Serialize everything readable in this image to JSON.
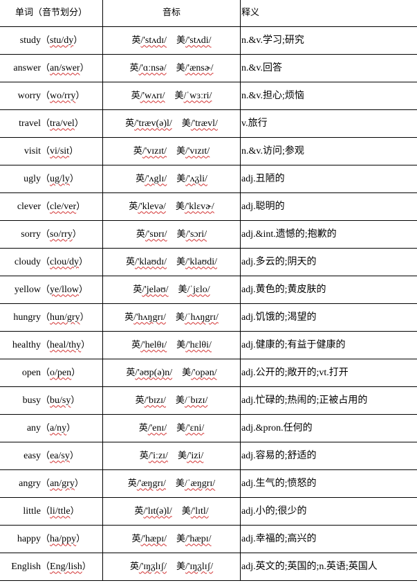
{
  "header": {
    "col_word": "单词（音节划分）",
    "col_phonetic": "音标",
    "col_meaning": "释义"
  },
  "labels": {
    "uk": "英",
    "us": "美"
  },
  "rows": [
    {
      "word": "study",
      "syllables": "stu/dy",
      "uk": "/'stʌdɪ/",
      "us": "/'stʌdi/",
      "meaning": "n.&v.学习;研究"
    },
    {
      "word": "answer",
      "syllables": "an/swer",
      "uk": "/'ɑːnsə/",
      "us": "/'ænsɚ/",
      "meaning": "n.&v.回答"
    },
    {
      "word": "worry",
      "syllables": "wo/rry",
      "uk": "/'wʌrɪ/",
      "us": "/ˈwɜːri/",
      "meaning": "n.&v.担心;烦恼"
    },
    {
      "word": "travel",
      "syllables": "tra/vel",
      "uk": "/'træv(ə)l/",
      "us": "/'trævl/",
      "meaning": "v.旅行"
    },
    {
      "word": "visit",
      "syllables": "vi/sit",
      "uk": "/'vɪzɪt/",
      "us": "/'vɪzɪt/",
      "meaning": "n.&v.访问;参观"
    },
    {
      "word": "ugly",
      "syllables": "ug/ly",
      "uk": "/'ʌglɪ/",
      "us": "/'ʌᵹli/",
      "meaning": "adj.丑陋的"
    },
    {
      "word": "clever",
      "syllables": "cle/ver",
      "uk": "/'klevə/",
      "us": "/'klɛvɚ/",
      "meaning": "adj.聪明的"
    },
    {
      "word": "sorry",
      "syllables": "so/rry",
      "uk": "/'sɒrɪ/",
      "us": "/'sɔri/",
      "meaning": "adj.&int.遗憾的;抱歉的"
    },
    {
      "word": "cloudy",
      "syllables": "clou/dy",
      "uk": "/'klaʊdɪ/",
      "us": "/'klaʊdi/",
      "meaning": "adj.多云的;阴天的"
    },
    {
      "word": "yellow",
      "syllables": "ye/llow",
      "uk": "/'jeləʊ/",
      "us": "/ˈjɛlo/",
      "meaning": "adj.黄色的;黄皮肤的"
    },
    {
      "word": "hungry",
      "syllables": "hun/gry",
      "uk": "/'hʌŋgrɪ/",
      "us": "/ˈhʌŋgrɪ/",
      "meaning": "adj.饥饿的;渴望的"
    },
    {
      "word": "healthy",
      "syllables": "heal/thy",
      "uk": "/'helθɪ/",
      "us": "/'hɛlθi/",
      "meaning": "adj.健康的;有益于健康的"
    },
    {
      "word": "open",
      "syllables": "o/pen",
      "uk": "/'əʊp(ə)n/",
      "us": "/'opən/",
      "meaning": "adj.公开的;敞开的;vt.打开"
    },
    {
      "word": "busy",
      "syllables": "bu/sy",
      "uk": "/'bɪzɪ/",
      "us": "/ˈbɪzɪ/",
      "meaning": "adj.忙碌的;热闹的;正被占用的"
    },
    {
      "word": "any",
      "syllables": "a/ny",
      "uk": "/'enɪ/",
      "us": "/'ɛni/",
      "meaning": "adj.&pron.任何的"
    },
    {
      "word": "easy",
      "syllables": "ea/sy",
      "uk": "/'iːzɪ/",
      "us": "/'izi/",
      "meaning": "adj.容易的;舒适的"
    },
    {
      "word": "angry",
      "syllables": "an/gry",
      "uk": "/'æŋgrɪ/",
      "us": "/ˈæŋgrɪ/",
      "meaning": "adj.生气的;愤怒的"
    },
    {
      "word": "little",
      "syllables": "li/ttle",
      "uk": "/'lɪt(ə)l/",
      "us": "/'lɪtl/",
      "meaning": "adj.小的;很少的"
    },
    {
      "word": "happy",
      "syllables": "ha/ppy",
      "uk": "/'hæpɪ/",
      "us": "/'hæpɪ/",
      "meaning": "adj.幸福的;高兴的"
    },
    {
      "word": "English",
      "syllables": "Eng/lish",
      "uk": "/'ɪŋᵹlɪʃ/",
      "us": "/'ɪŋᵹlɪʃ/",
      "meaning": "adj.英文的;英国的;n.英语;英国人"
    }
  ]
}
